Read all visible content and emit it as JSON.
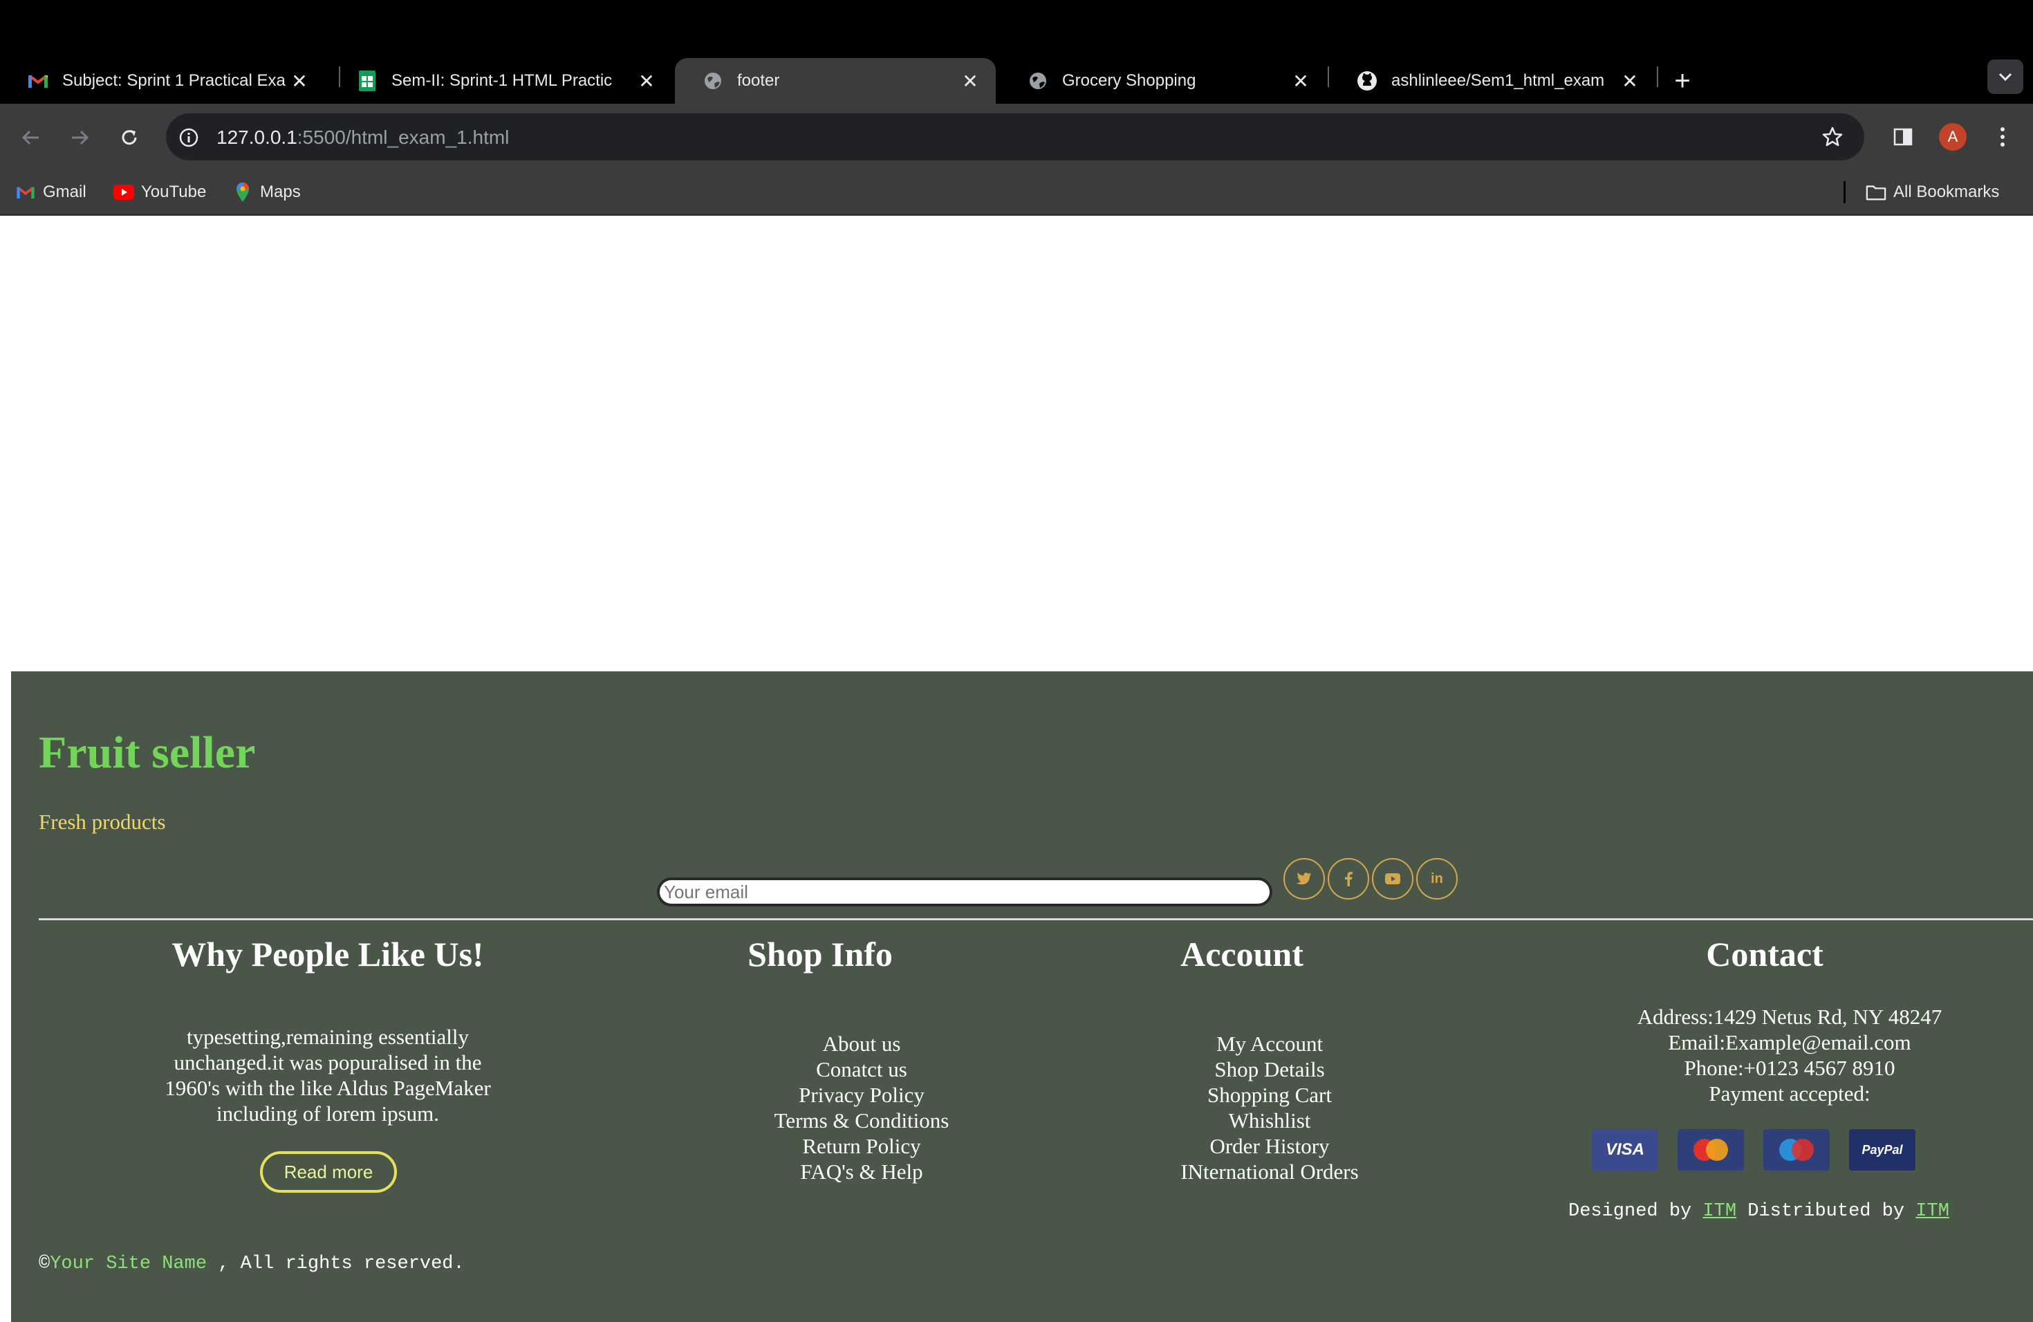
{
  "browser": {
    "tabs": [
      {
        "title": "Subject: Sprint 1 Practical Exa",
        "icon": "gmail-icon",
        "active": false
      },
      {
        "title": "Sem-II: Sprint-1 HTML Practic",
        "icon": "sheets-icon",
        "active": false
      },
      {
        "title": "footer",
        "icon": "globe-icon",
        "active": true
      },
      {
        "title": "Grocery Shopping",
        "icon": "globe-icon",
        "active": false
      },
      {
        "title": "ashlinleee/Sem1_html_exam",
        "icon": "github-icon",
        "active": false
      }
    ],
    "url_host": "127.0.0.1",
    "url_path": ":5500/html_exam_1.html",
    "profile_initial": "A",
    "bookmarks": [
      {
        "label": "Gmail",
        "icon": "gmail-icon"
      },
      {
        "label": "YouTube",
        "icon": "youtube-icon"
      },
      {
        "label": "Maps",
        "icon": "maps-icon"
      }
    ],
    "all_bookmarks_label": "All Bookmarks"
  },
  "footer": {
    "brand": "Fruit seller",
    "tagline": "Fresh products",
    "email_placeholder": "Your email",
    "social_icons": [
      "twitter-icon",
      "facebook-icon",
      "youtube-icon",
      "linkedin-icon"
    ],
    "why": {
      "title": "Why People Like Us!",
      "text": "typesetting,remaining essentially unchanged.it was popuralised in the 1960's with the like Aldus PageMaker including of lorem ipsum.",
      "button": "Read more"
    },
    "shop_info": {
      "title": "Shop Info",
      "links": [
        "About us",
        "Conatct us",
        "Privacy Policy",
        "Terms & Conditions",
        "Return Policy",
        "FAQ's & Help"
      ]
    },
    "account": {
      "title": "Account",
      "links": [
        "My Account",
        "Shop Details",
        "Shopping Cart",
        "Whishlist",
        "Order History",
        "INternational Orders"
      ]
    },
    "contact": {
      "title": "Contact",
      "address": "Address:1429 Netus Rd, NY 48247",
      "email": "Email:Example@email.com",
      "phone": "Phone:+0123 4567 8910",
      "payment_label": "Payment accepted:",
      "payment_cards": [
        "VISA",
        "MasterCard",
        "Maestro",
        "PayPal"
      ]
    },
    "credits": {
      "designed_prefix": "Designed by ",
      "designed_link": "ITM",
      "distributed_prefix": " Distributed by ",
      "distributed_link": "ITM"
    },
    "copyright": {
      "symbol": "©",
      "site_name": "Your Site Name",
      "suffix": " , All rights reserved."
    }
  },
  "colors": {
    "footer_bg": "#4a5648",
    "brand": "#72d55a",
    "tagline": "#f3d66d",
    "link_green": "#8ee07c",
    "social_border": "#d4a64d",
    "read_more_border": "#e8df5a"
  }
}
